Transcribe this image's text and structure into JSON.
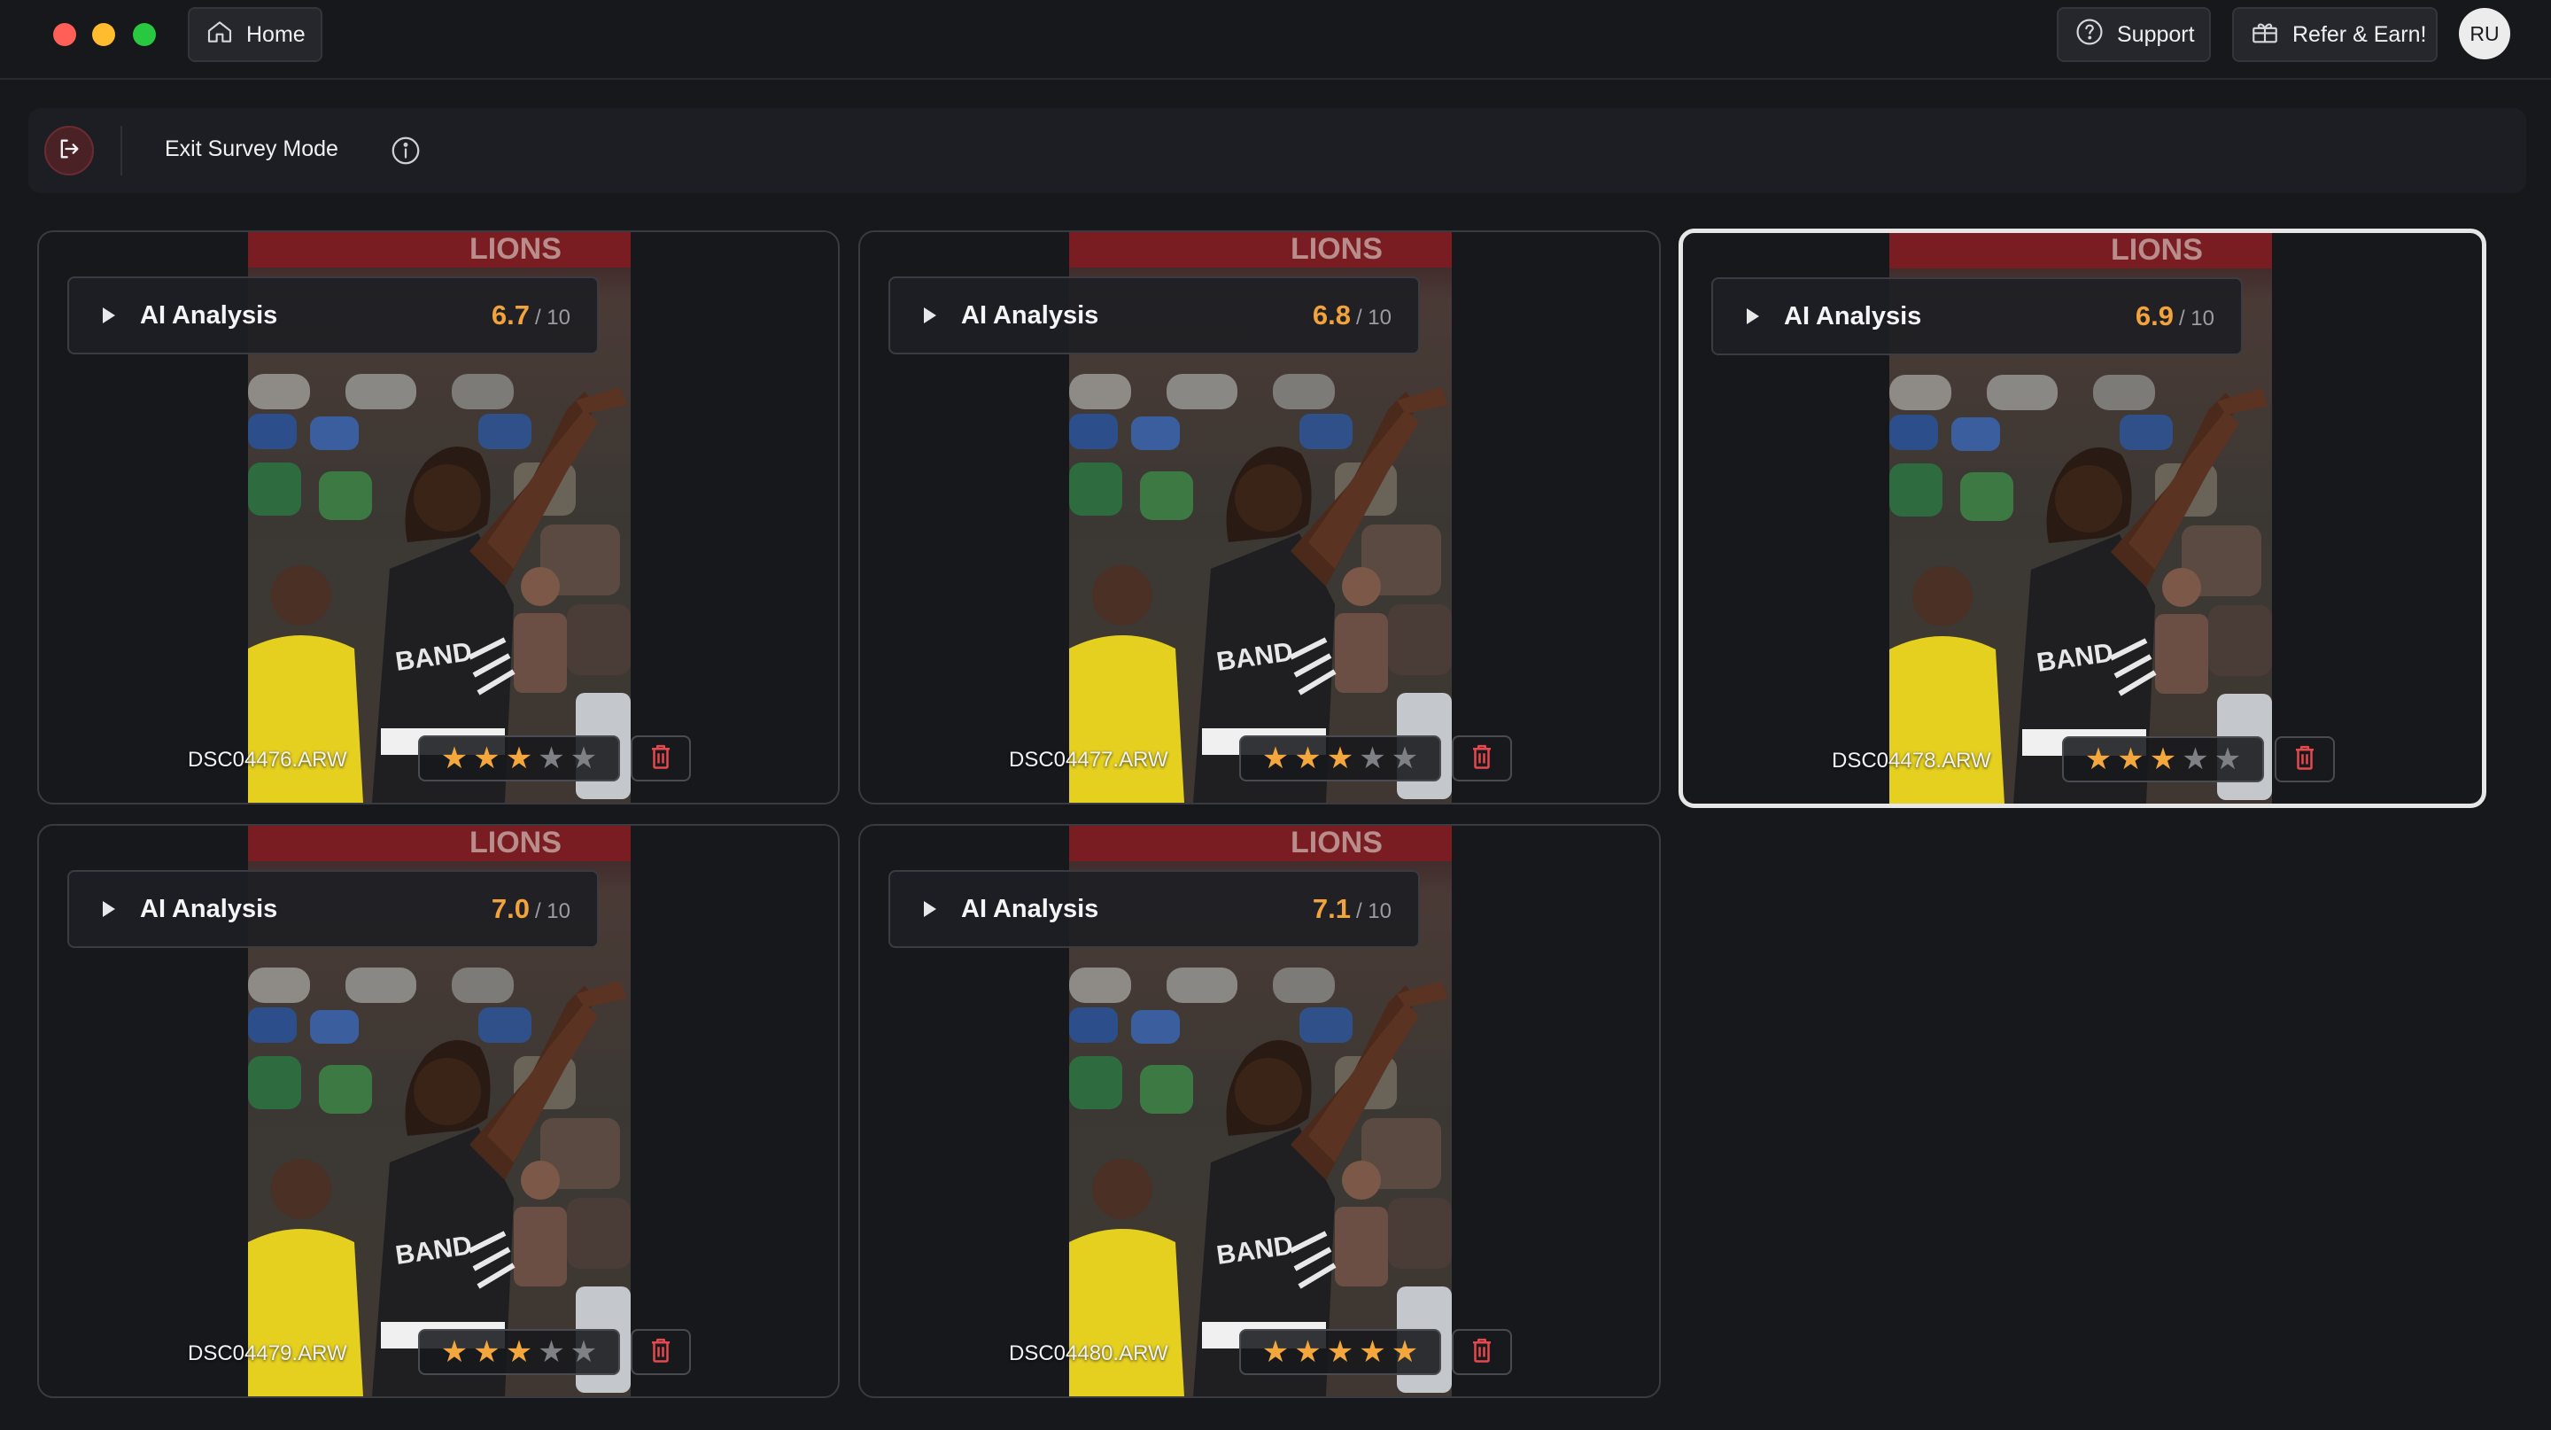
{
  "topbar": {
    "home_label": "Home",
    "support_label": "Support",
    "refer_label": "Refer & Earn!",
    "avatar_initials": "RU"
  },
  "survey_bar": {
    "exit_label": "Exit Survey Mode"
  },
  "cards": [
    {
      "ai_label": "AI Analysis",
      "score": "6.7",
      "score_out_of": "/ 10",
      "filename": "DSC04476.ARW",
      "rating": 3,
      "selected": false
    },
    {
      "ai_label": "AI Analysis",
      "score": "6.8",
      "score_out_of": "/ 10",
      "filename": "DSC04477.ARW",
      "rating": 3,
      "selected": false
    },
    {
      "ai_label": "AI Analysis",
      "score": "6.9",
      "score_out_of": "/ 10",
      "filename": "DSC04478.ARW",
      "rating": 3,
      "selected": true
    },
    {
      "ai_label": "AI Analysis",
      "score": "7.0",
      "score_out_of": "/ 10",
      "filename": "DSC04479.ARW",
      "rating": 3,
      "selected": false
    },
    {
      "ai_label": "AI Analysis",
      "score": "7.1",
      "score_out_of": "/ 10",
      "filename": "DSC04480.ARW",
      "rating": 5,
      "selected": false
    }
  ],
  "colors": {
    "accent_score": "#f3a33c",
    "star_on": "#f3a73c",
    "star_off": "#7f8085",
    "danger": "#e5484d"
  },
  "icons": [
    "home-icon",
    "help-circle-icon",
    "gift-icon",
    "exit-icon",
    "info-icon",
    "play-icon",
    "star-icon",
    "trash-icon"
  ]
}
